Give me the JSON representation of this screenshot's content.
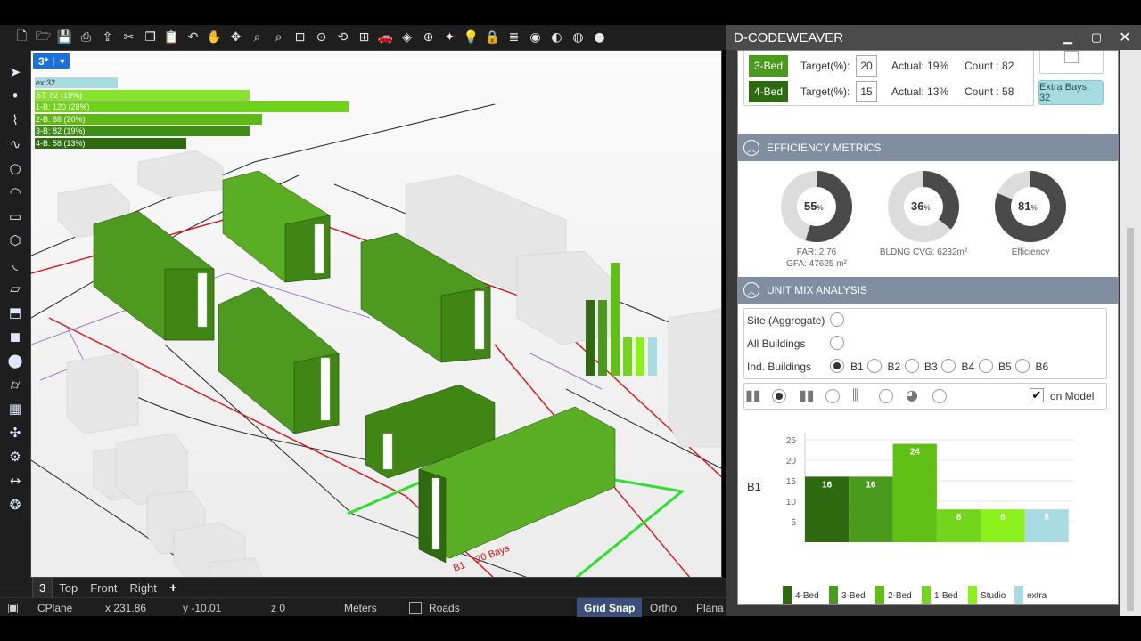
{
  "toolbar": {
    "icons": [
      "new-file-icon",
      "open-folder-icon",
      "save-icon",
      "print-icon",
      "import-icon",
      "cut-icon",
      "copy-icon",
      "paste-icon",
      "undo-icon",
      "pan-hand-icon",
      "rotate-view-icon",
      "zoom-icon",
      "zoom-window-icon",
      "zoom-extents-icon",
      "zoom-selected-icon",
      "rotate-camera-icon",
      "four-viewports-icon",
      "car-icon",
      "named-views-icon",
      "cplane-icon",
      "osnap-icon",
      "light-bulb-icon",
      "lock-icon",
      "layer-icon",
      "color-wheel-icon",
      "render-icon",
      "material-icon",
      "sphere-icon"
    ]
  },
  "lefttools": {
    "icons": [
      "select-arrow-icon",
      "point-icon",
      "polyline-icon",
      "curve-icon",
      "circle-icon",
      "arc-icon",
      "rectangle-icon",
      "polygon-icon",
      "fillet-icon",
      "surface-icon",
      "extrude-icon",
      "box-solid-icon",
      "sphere-solid-icon",
      "cylinder-icon",
      "mesh-icon",
      "transform-icon",
      "analyze-icon",
      "dimension-icon",
      "render-tool-icon"
    ]
  },
  "viewport": {
    "tag": "3*",
    "hud": [
      {
        "label": "ex:32",
        "color": "#a9dbe3",
        "frac": 0.25,
        "text": "#333"
      },
      {
        "label": "ST: 82  (19%)",
        "color": "#86e52a",
        "frac": 0.65,
        "text": "#fff"
      },
      {
        "label": "1-B: 120  (28%)",
        "color": "#6fd11a",
        "frac": 0.95,
        "text": "#fff"
      },
      {
        "label": "2-B: 88  (20%)",
        "color": "#5eb817",
        "frac": 0.69,
        "text": "#fff"
      },
      {
        "label": "3-B: 82  (19%)",
        "color": "#3f8d14",
        "frac": 0.65,
        "text": "#fff"
      },
      {
        "label": "4-B: 58  (13%)",
        "color": "#2e6a10",
        "frac": 0.46,
        "text": "#fff"
      }
    ],
    "annotations": {
      "bays": "20 Bays",
      "b1": "B1"
    }
  },
  "tabs": [
    {
      "label": "3",
      "active": true
    },
    {
      "label": "Top",
      "active": false
    },
    {
      "label": "Front",
      "active": false
    },
    {
      "label": "Right",
      "active": false
    },
    {
      "label": "+",
      "active": false
    }
  ],
  "status": {
    "cplane": "CPlane",
    "x": "x 231.86",
    "y": "y -10.01",
    "z": "z 0",
    "units": "Meters",
    "roads": "Roads",
    "gridsnap": "Grid Snap",
    "ortho": "Ortho",
    "planar": "Plana"
  },
  "panel": {
    "title": "D-CODEWEAVER",
    "unit_rows": [
      {
        "swatch": "3-Bed",
        "color": "#4a9a1e",
        "target_label": "Target(%):",
        "target": "20",
        "actual": "Actual: 19%",
        "count": "Count : 82"
      },
      {
        "swatch": "4-Bed",
        "color": "#2e6a10",
        "target_label": "Target(%):",
        "target": "15",
        "actual": "Actual: 13%",
        "count": "Count : 58"
      }
    ],
    "extra_bays": "Extra Bays: 32",
    "efficiency": {
      "title": "EFFICIENCY METRICS",
      "donuts": [
        {
          "value": "55",
          "pct": "%",
          "fill": 0.55,
          "caption1": "FAR: 2.76",
          "caption2": "GFA: 47625 m²"
        },
        {
          "value": "36",
          "pct": "%",
          "fill": 0.36,
          "caption1": "BLDNG CVG: 6232m²",
          "caption2": ""
        },
        {
          "value": "81",
          "pct": "%",
          "fill": 0.81,
          "caption1": "Efficiency",
          "caption2": ""
        }
      ]
    },
    "unitmix": {
      "title": "UNIT MIX ANALYSIS",
      "site": "Site (Aggregate)",
      "all": "All Buildings",
      "ind": "Ind. Buildings",
      "buildings": [
        "B1",
        "B2",
        "B3",
        "B4",
        "B5",
        "B6"
      ],
      "on_model": "on Model",
      "chart_label": "B1"
    }
  },
  "chart_data": [
    {
      "type": "bar",
      "categories": [
        "4-Bed",
        "3-Bed",
        "2-Bed",
        "1-Bed",
        "Studio",
        "extra"
      ],
      "values": [
        16,
        16,
        24,
        8,
        8,
        8
      ],
      "colors": [
        "#2e6a10",
        "#4a9a1e",
        "#5fbf12",
        "#74d51e",
        "#8cf01c",
        "#a9dbe3"
      ],
      "ylim": [
        0,
        25
      ],
      "yticks": [
        5,
        10,
        15,
        20,
        25
      ],
      "ylabel": "B1",
      "legend": "bottom"
    }
  ]
}
